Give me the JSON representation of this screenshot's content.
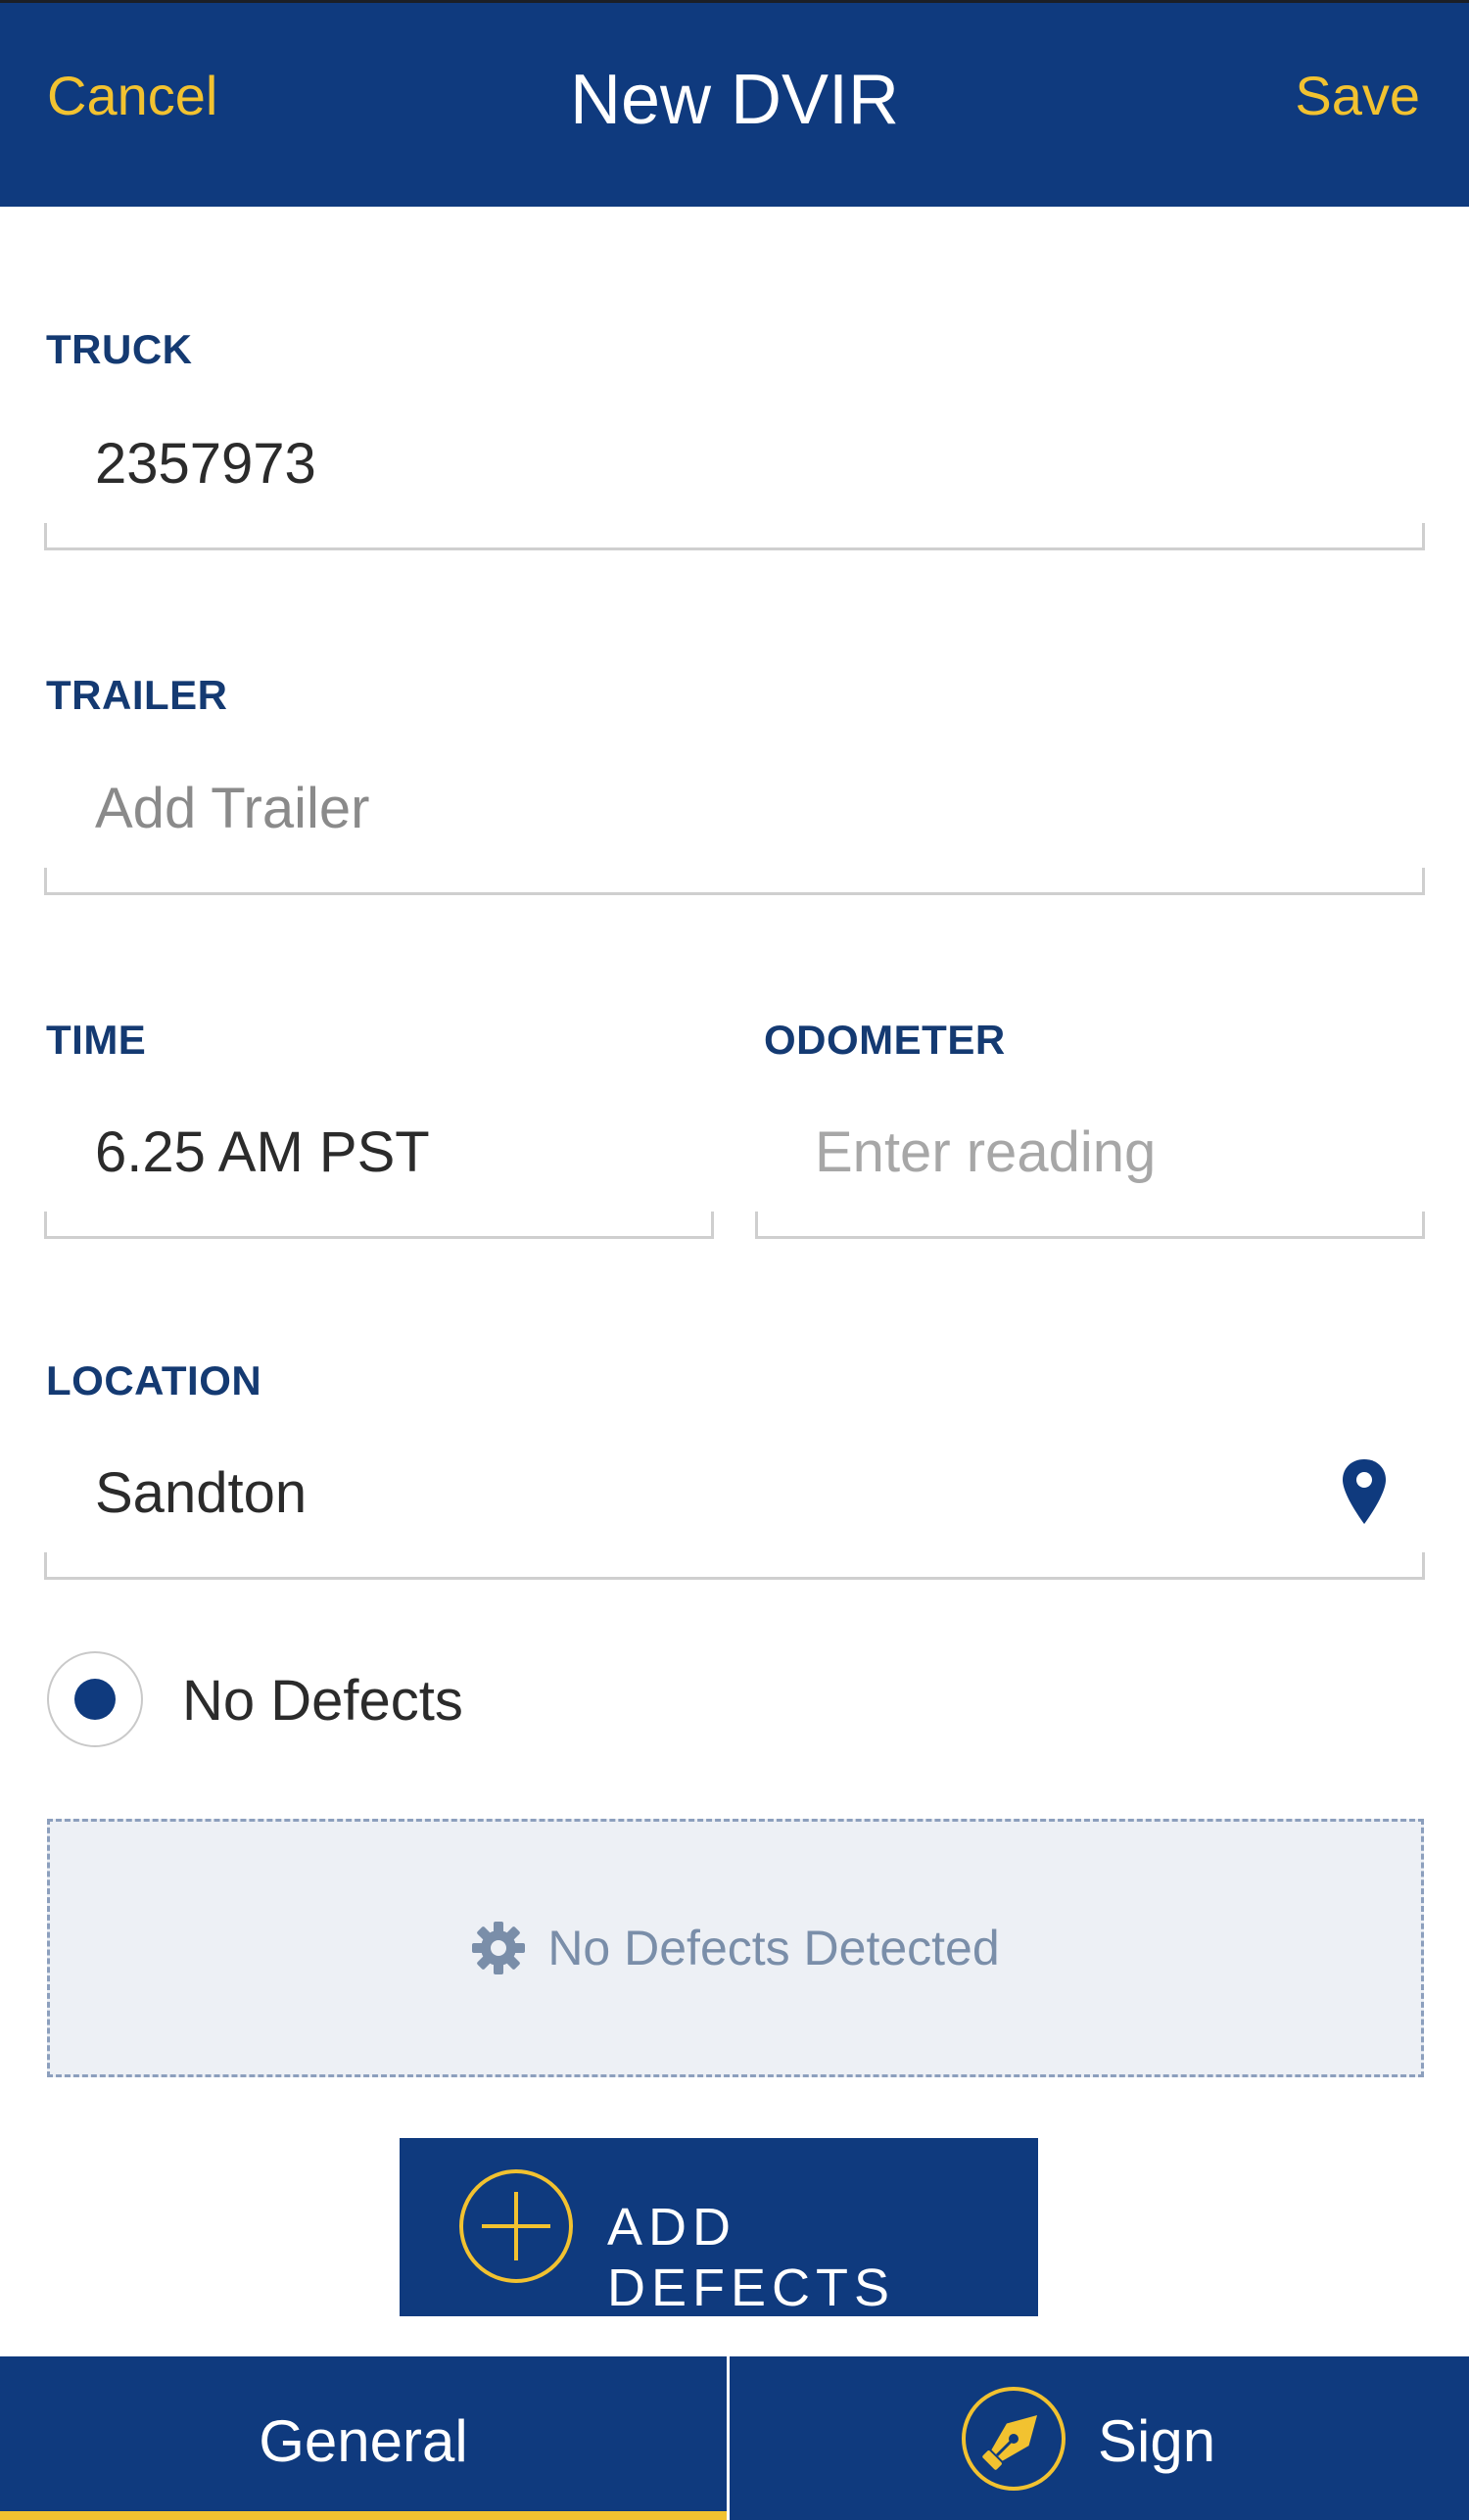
{
  "header": {
    "cancel_label": "Cancel",
    "title": "New DVIR",
    "save_label": "Save"
  },
  "form": {
    "truck": {
      "label": "TRUCK",
      "value": "2357973"
    },
    "trailer": {
      "label": "TRAILER",
      "placeholder": "Add Trailer"
    },
    "time": {
      "label": "TIME",
      "value": "6.25 AM PST"
    },
    "odometer": {
      "label": "ODOMETER",
      "placeholder": "Enter reading"
    },
    "location": {
      "label": "LOCATION",
      "value": "Sandton",
      "icon": "location-pin-icon"
    }
  },
  "defects": {
    "radio_label": "No Defects",
    "radio_selected": true,
    "status_text": "No Defects Detected",
    "status_icon": "gear-icon",
    "add_button_label": "ADD DEFECTS",
    "add_button_icon": "plus-circle-icon"
  },
  "tabs": [
    {
      "label": "General",
      "active": true
    },
    {
      "label": "Sign",
      "active": false,
      "icon": "pen-nib-icon"
    }
  ],
  "colors": {
    "primary": "#0f3a7e",
    "accent": "#f2c230",
    "label": "#143a72",
    "defect_text": "#7a8ea9",
    "defect_bg": "#edf0f5"
  }
}
